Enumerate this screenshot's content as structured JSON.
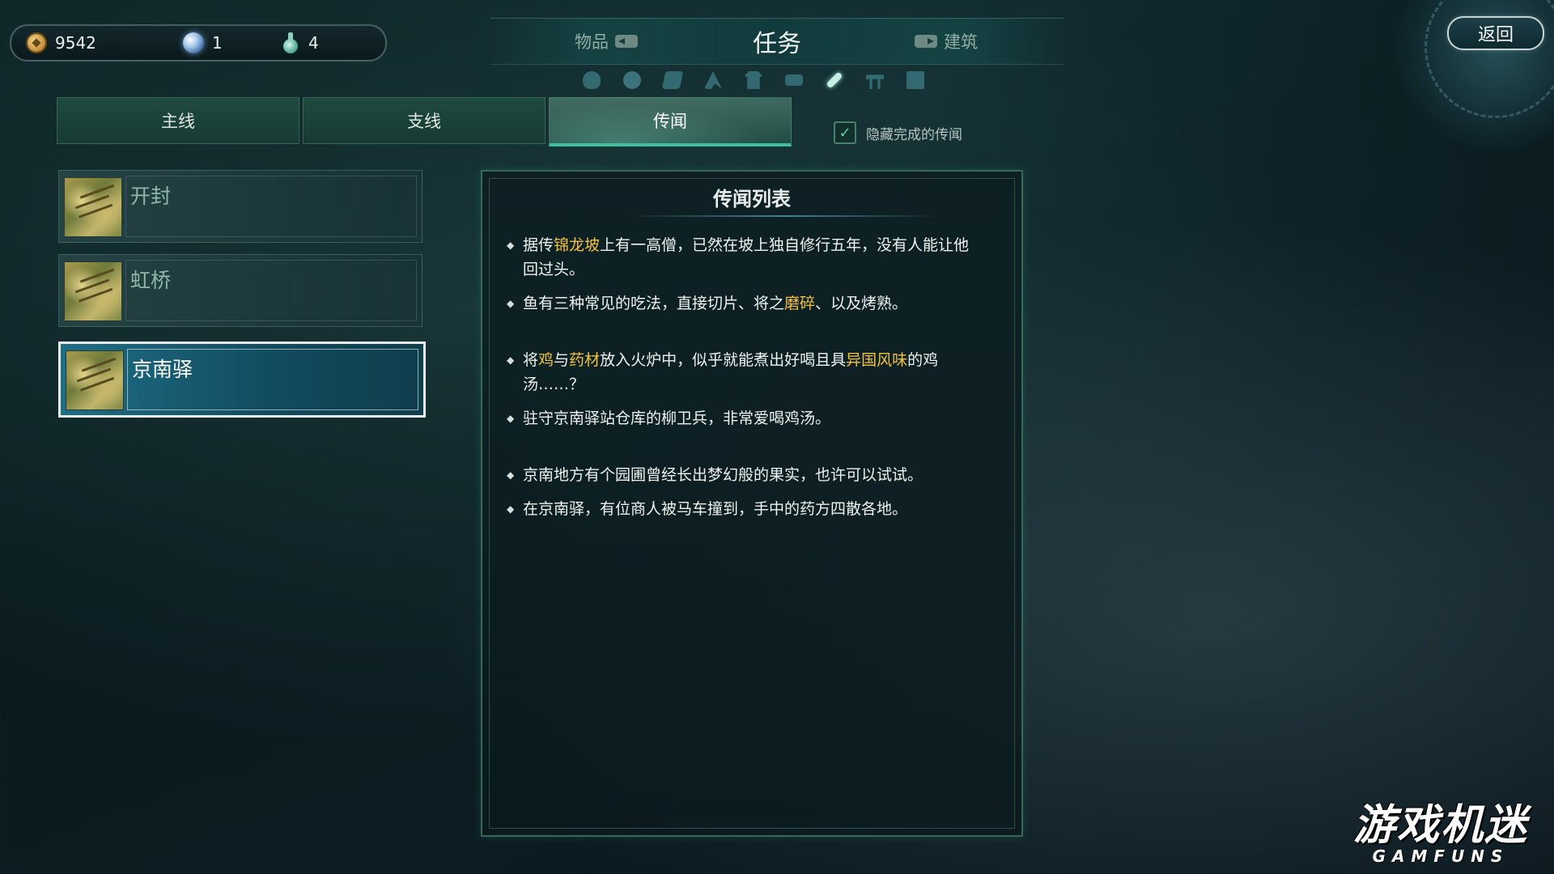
{
  "currency": {
    "coins": "9542",
    "orbs": "1",
    "essence": "4"
  },
  "top_tabs": {
    "left": "物品",
    "active": "任务",
    "right": "建筑"
  },
  "categories": [
    "mask-icon",
    "swirl-icon",
    "book-icon",
    "figure-icon",
    "armor-icon",
    "table-icon",
    "brush-icon",
    "gate-icon",
    "scroll-icon"
  ],
  "back_label": "返回",
  "sub_tabs": [
    "主线",
    "支线",
    "传闻"
  ],
  "active_sub_tab": "传闻",
  "hide_completed": {
    "label": "隐藏完成的传闻",
    "checked": true
  },
  "locations": [
    {
      "name": "开封",
      "selected": false
    },
    {
      "name": "虹桥",
      "selected": false
    },
    {
      "name": "京南驿",
      "selected": true
    }
  ],
  "panel": {
    "title": "传闻列表",
    "highlight_color": "#f2c23e",
    "rumors": [
      [
        {
          "t": "据传"
        },
        {
          "t": "锦龙坡",
          "hl": true
        },
        {
          "t": "上有一高僧，已然在坡上独自修行五年，没有人能让他回过头。"
        }
      ],
      [
        {
          "t": "鱼有三种常见的吃法，直接切片、将之"
        },
        {
          "t": "磨碎",
          "hl": true
        },
        {
          "t": "、以及烤熟。"
        }
      ],
      [
        {
          "t": "将"
        },
        {
          "t": "鸡",
          "hl": true
        },
        {
          "t": "与"
        },
        {
          "t": "药材",
          "hl": true
        },
        {
          "t": "放入火炉中，似乎就能煮出好喝且具"
        },
        {
          "t": "异国风味",
          "hl": true
        },
        {
          "t": "的鸡汤……？"
        }
      ],
      [
        {
          "t": "驻守京南驿站仓库的柳卫兵，非常爱喝鸡汤。"
        }
      ],
      [
        {
          "t": "京南地方有个园圃曾经长出梦幻般的果实，也许可以试试。"
        }
      ],
      [
        {
          "t": "在京南驿，有位商人被马车撞到，手中的药方四散各地。"
        }
      ]
    ]
  },
  "watermark": {
    "cn": "游戏机迷",
    "en": "GAMFUNS"
  }
}
